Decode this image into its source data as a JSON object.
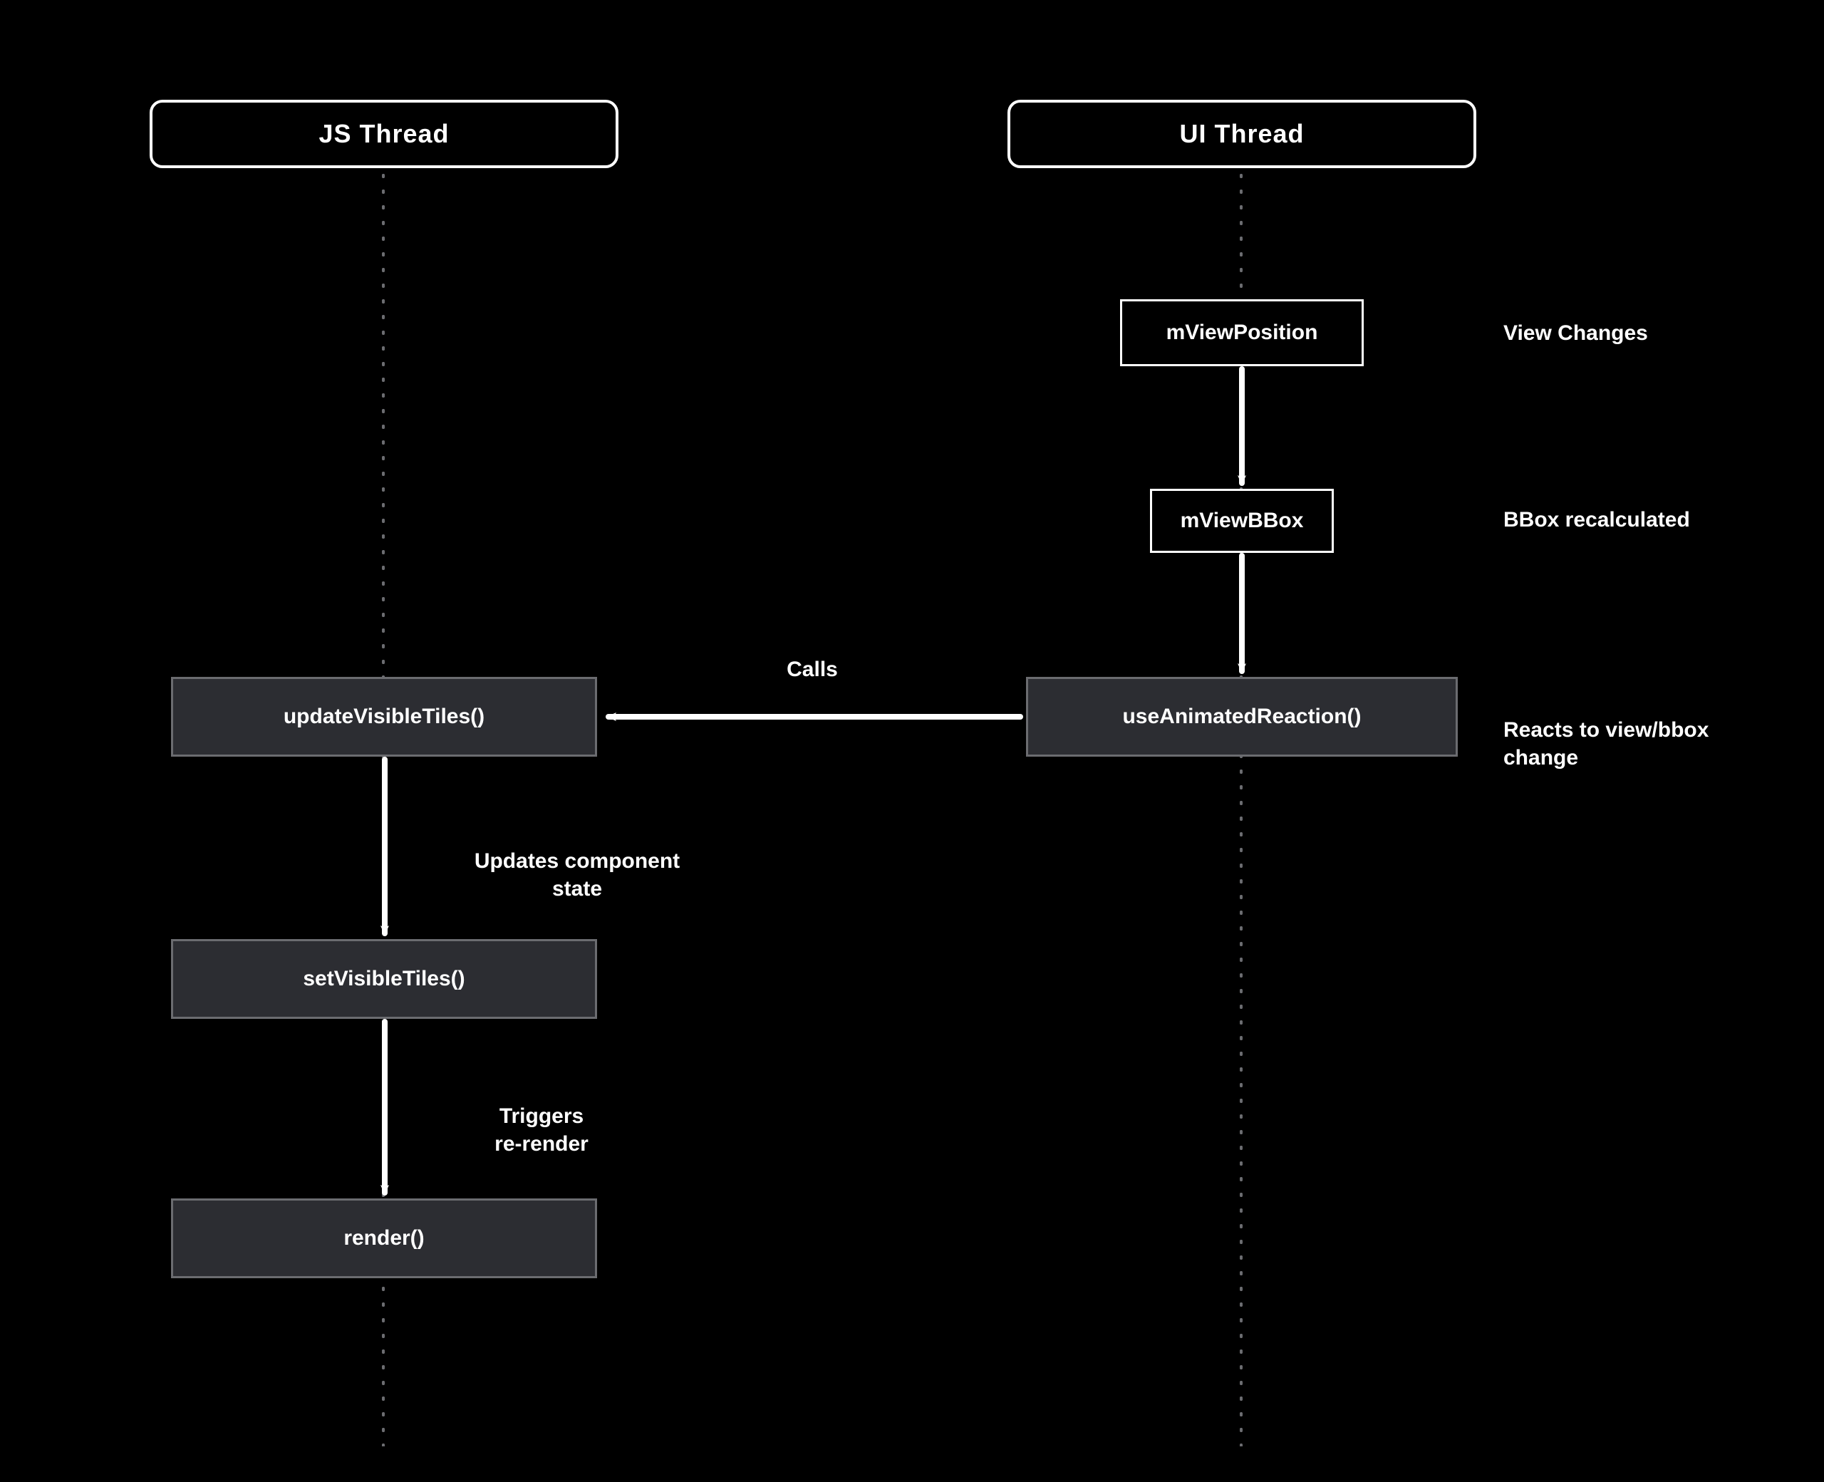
{
  "diagram": {
    "lanes": {
      "js": {
        "title": "JS Thread"
      },
      "ui": {
        "title": "UI Thread"
      }
    },
    "nodes": {
      "mViewPosition": {
        "label": "mViewPosition"
      },
      "mViewBBox": {
        "label": "mViewBBox"
      },
      "useAnimatedReaction": {
        "label": "useAnimatedReaction()"
      },
      "updateVisibleTiles": {
        "label": "updateVisibleTiles()"
      },
      "setVisibleTiles": {
        "label": "setVisibleTiles()"
      },
      "render": {
        "label": "render()"
      }
    },
    "edgeLabels": {
      "calls": "Calls",
      "updatesState": "Updates component\nstate",
      "triggersRerender": "Triggers\nre-render"
    },
    "annotations": {
      "viewChanges": "View Changes",
      "bboxRecalculated": "BBox recalculated",
      "reactsToChange": "Reacts to view/bbox\nchange"
    },
    "colors": {
      "background": "#000000",
      "stroke": "#ffffff",
      "fillNode": "#2c2d32",
      "fillNodeBorder": "#6b6c70",
      "dotted": "#6b6c70"
    }
  }
}
